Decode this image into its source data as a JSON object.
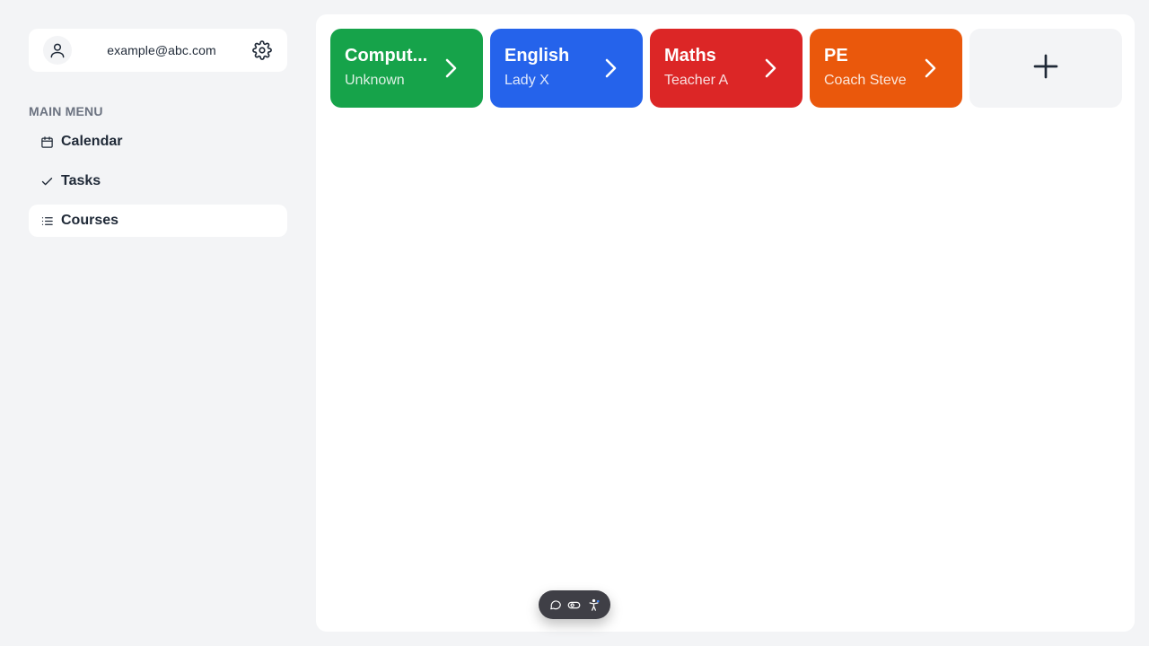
{
  "account": {
    "email": "example@abc.com",
    "avatar_icon": "user-icon",
    "settings_icon": "gear-icon"
  },
  "menu": {
    "heading": "MAIN MENU",
    "items": [
      {
        "label": "Calendar",
        "icon": "calendar-icon",
        "active": false
      },
      {
        "label": "Tasks",
        "icon": "check-icon",
        "active": false
      },
      {
        "label": "Courses",
        "icon": "list-icon",
        "active": true
      }
    ]
  },
  "courses": [
    {
      "name": "Comput...",
      "teacher": "Unknown",
      "color": "#16a34a"
    },
    {
      "name": "English",
      "teacher": "Lady X",
      "color": "#2563eb"
    },
    {
      "name": "Maths",
      "teacher": "Teacher A",
      "color": "#dc2626"
    },
    {
      "name": "PE",
      "teacher": "Coach Steve",
      "color": "#ea580c"
    }
  ],
  "add_course": {
    "icon": "plus-icon"
  },
  "toolbar": {
    "icons": [
      "comment-icon",
      "toggle-icon",
      "accessibility-icon"
    ]
  }
}
